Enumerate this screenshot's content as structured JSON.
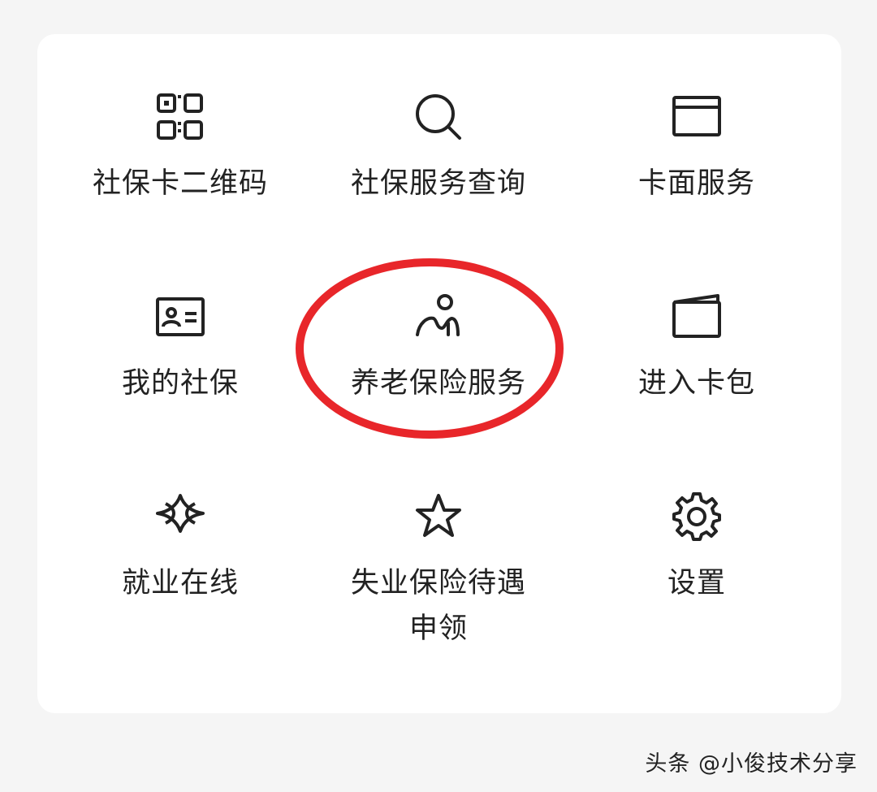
{
  "menu": {
    "items": [
      {
        "label": "社保卡二维码",
        "icon": "qr-code-icon"
      },
      {
        "label": "社保服务查询",
        "icon": "search-icon"
      },
      {
        "label": "卡面服务",
        "icon": "card-icon"
      },
      {
        "label": "我的社保",
        "icon": "id-card-icon"
      },
      {
        "label": "养老保险服务",
        "icon": "elder-person-icon"
      },
      {
        "label": "进入卡包",
        "icon": "wallet-icon"
      },
      {
        "label": "就业在线",
        "icon": "employment-icon"
      },
      {
        "label": "失业保险待遇申领",
        "icon": "star-icon"
      },
      {
        "label": "设置",
        "icon": "gear-icon"
      }
    ]
  },
  "annotation": {
    "shape": "ellipse",
    "color": "#e8262a",
    "target": "养老保险服务"
  },
  "watermark": "头条 @小俊技术分享"
}
